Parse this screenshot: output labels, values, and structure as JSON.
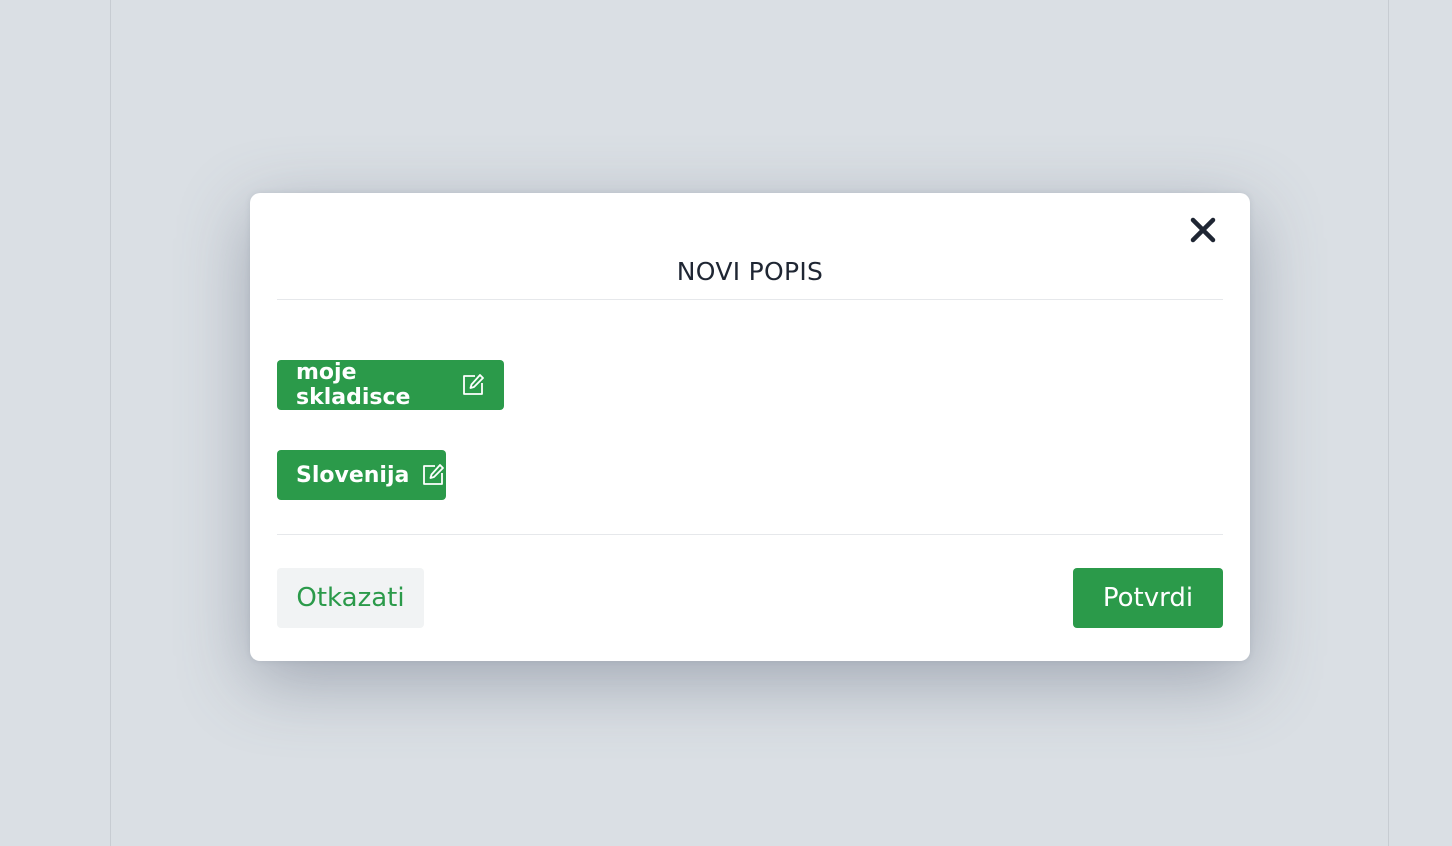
{
  "modal": {
    "title": "NOVI POPIS",
    "close_icon": "close-icon",
    "selections": [
      {
        "label": "moje skladisce",
        "icon": "edit-icon"
      },
      {
        "label": "Slovenija",
        "icon": "edit-icon"
      }
    ],
    "cancel_label": "Otkazati",
    "confirm_label": "Potvrdi"
  },
  "colors": {
    "accent": "#2b9a4a",
    "backdrop": "#dadfe4",
    "title_text": "#1f2633",
    "cancel_bg": "#f1f3f4"
  }
}
